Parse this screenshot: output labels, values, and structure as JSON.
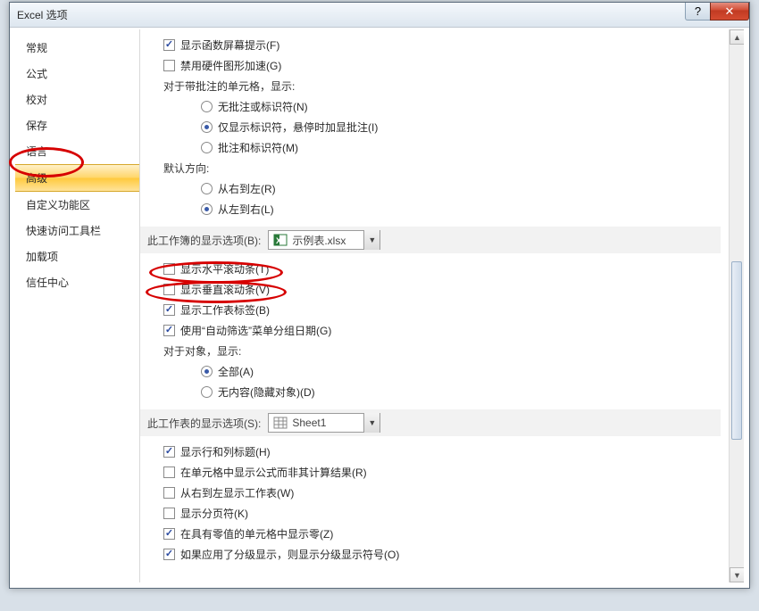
{
  "title": "Excel 选项",
  "title_buttons": {
    "help": "?",
    "close": "✕"
  },
  "sidebar": {
    "items": [
      {
        "label": "常规"
      },
      {
        "label": "公式"
      },
      {
        "label": "校对"
      },
      {
        "label": "保存"
      },
      {
        "label": "语言"
      },
      {
        "label": "高级",
        "selected": true
      },
      {
        "label": "自定义功能区"
      },
      {
        "label": "快速访问工具栏"
      },
      {
        "label": "加载项"
      },
      {
        "label": "信任中心"
      }
    ]
  },
  "content": {
    "show_function_tips": "显示函数屏幕提示(F)",
    "disable_hw_accel": "禁用硬件图形加速(G)",
    "comments_header": "对于带批注的单元格，显示:",
    "comments_none": "无批注或标识符(N)",
    "comments_indicator": "仅显示标识符，悬停时加显批注(I)",
    "comments_both": "批注和标识符(M)",
    "default_dir": "默认方向:",
    "rtl": "从右到左(R)",
    "ltr": "从左到右(L)",
    "workbook_section": "此工作簿的显示选项(B):",
    "workbook_name": "示例表.xlsx",
    "hscroll": "显示水平滚动条(T)",
    "vscroll": "显示垂直滚动条(V)",
    "sheet_tabs": "显示工作表标签(B)",
    "autofilter_date": "使用“自动筛选”菜单分组日期(G)",
    "objects_header": "对于对象，显示:",
    "obj_all": "全部(A)",
    "obj_none": "无内容(隐藏对象)(D)",
    "sheet_section": "此工作表的显示选项(S):",
    "sheet_name": "Sheet1",
    "row_col_headers": "显示行和列标题(H)",
    "show_formulas": "在单元格中显示公式而非其计算结果(R)",
    "rtl_sheet": "从右到左显示工作表(W)",
    "page_breaks": "显示分页符(K)",
    "show_zero": "在具有零值的单元格中显示零(Z)",
    "outline_symbols": "如果应用了分级显示，则显示分级显示符号(O)"
  }
}
